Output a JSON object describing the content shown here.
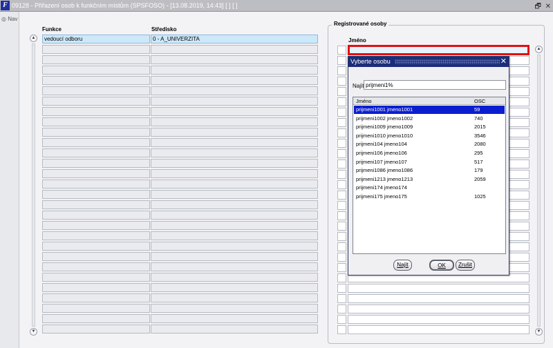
{
  "window": {
    "title": "09128 - Přiřazení osob k funkčním místům (SPSFOSO) - [13.08.2019, 14:43]  [ ]  [ ]",
    "icon": "app-logo-icon",
    "restore_glyph": "🗗",
    "close_glyph": "✕"
  },
  "nav": {
    "label": "Nav"
  },
  "left_grid": {
    "headers": {
      "funkce": "Funkce",
      "stredisko": "Středisko"
    },
    "rows": [
      {
        "funkce": "vedoucí odboru",
        "stredisko": "0 - A_UNIVERZITA",
        "selected": true
      }
    ],
    "empty_row_count": 28
  },
  "right_group": {
    "legend": "Registrované osoby",
    "header": "Jméno"
  },
  "dialog": {
    "title": "Vyberte osobu",
    "find_label": "Najít",
    "find_value": "prijmeni1%",
    "columns": {
      "jmeno": "Jméno",
      "osc": "OSC"
    },
    "items": [
      {
        "jmeno": "prijmeni1001 jmeno1001",
        "osc": "59"
      },
      {
        "jmeno": "prijmeni1002 jmeno1002",
        "osc": "740"
      },
      {
        "jmeno": "prijmeni1009 jmeno1009",
        "osc": "2015"
      },
      {
        "jmeno": "prijmeni1010 jmeno1010",
        "osc": "3546"
      },
      {
        "jmeno": "prijmeni104 jmeno104",
        "osc": "2080"
      },
      {
        "jmeno": "prijmeni106 jmeno106",
        "osc": "295"
      },
      {
        "jmeno": "prijmeni107 jmeno107",
        "osc": "517"
      },
      {
        "jmeno": "prijmeni1086 jmeno1086",
        "osc": "179"
      },
      {
        "jmeno": "prijmeni1213 jmeno1213",
        "osc": "2059"
      },
      {
        "jmeno": "prijmeni174 jmeno174",
        "osc": ""
      },
      {
        "jmeno": "prijmeni175 jmeno175",
        "osc": "1025"
      }
    ],
    "selected_index": 0,
    "buttons": {
      "find": "Najít",
      "ok": "OK",
      "cancel": "Zrušit"
    },
    "close_glyph": "✕"
  },
  "colors": {
    "title_bar": "#bdbec2",
    "dialog_title": "#1b2d7a",
    "selection": "#0b1ecf",
    "grid_selected_row": "#cde8f9",
    "focus_border": "#e01010"
  }
}
